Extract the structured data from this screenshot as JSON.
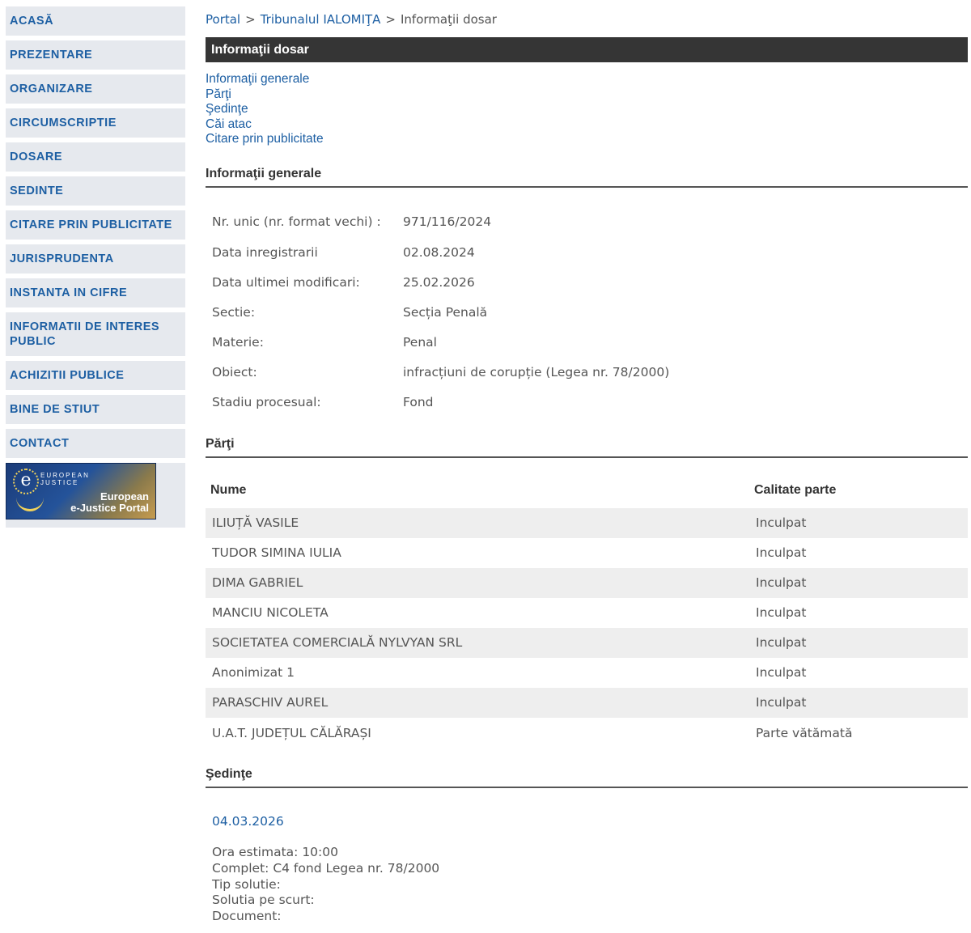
{
  "sidebar": {
    "items": [
      {
        "label": "ACASĂ"
      },
      {
        "label": "PREZENTARE"
      },
      {
        "label": "ORGANIZARE"
      },
      {
        "label": "CIRCUMSCRIPTIE"
      },
      {
        "label": "DOSARE"
      },
      {
        "label": "SEDINTE"
      },
      {
        "label": "CITARE PRIN PUBLICITATE"
      },
      {
        "label": "JURISPRUDENTA"
      },
      {
        "label": "INSTANTA IN CIFRE"
      },
      {
        "label": "INFORMATII DE INTERES PUBLIC"
      },
      {
        "label": "ACHIZITII PUBLICE"
      },
      {
        "label": "BINE DE STIUT"
      },
      {
        "label": "CONTACT"
      }
    ],
    "banner": {
      "logo_letter": "e",
      "top_text": "EUROPEAN JUSTICE",
      "line1": "European",
      "line2": "e-Justice Portal"
    }
  },
  "breadcrumb": {
    "portal": "Portal",
    "sep": ">",
    "court": "Tribunalul IALOMIŢA",
    "current": "Informaţii dosar"
  },
  "page_title": "Informaţii dosar",
  "jump_links": [
    {
      "label": "Informaţii generale"
    },
    {
      "label": "Părţi"
    },
    {
      "label": "Şedinţe"
    },
    {
      "label": "Căi atac"
    },
    {
      "label": "Citare prin publicitate"
    }
  ],
  "general": {
    "heading": "Informaţii generale",
    "rows": [
      {
        "key": "Nr. unic (nr. format vechi) :",
        "value": "971/116/2024"
      },
      {
        "key": "Data inregistrarii",
        "value": "02.08.2024"
      },
      {
        "key": "Data ultimei modificari:",
        "value": "25.02.2026"
      },
      {
        "key": "Sectie:",
        "value": "Secția Penală"
      },
      {
        "key": "Materie:",
        "value": "Penal"
      },
      {
        "key": "Obiect:",
        "value": "infracțiuni de corupție (Legea nr. 78/2000)"
      },
      {
        "key": "Stadiu procesual:",
        "value": "Fond"
      }
    ]
  },
  "parti": {
    "heading": "Părţi",
    "col_name": "Nume",
    "col_role": "Calitate parte",
    "rows": [
      {
        "name": "ILIUȚĂ VASILE",
        "role": "Inculpat"
      },
      {
        "name": "TUDOR SIMINA IULIA",
        "role": "Inculpat"
      },
      {
        "name": "DIMA GABRIEL",
        "role": "Inculpat"
      },
      {
        "name": "MANCIU NICOLETA",
        "role": "Inculpat"
      },
      {
        "name": "SOCIETATEA COMERCIALĂ NYLVYAN SRL",
        "role": "Inculpat"
      },
      {
        "name": "Anonimizat 1",
        "role": "Inculpat"
      },
      {
        "name": "PARASCHIV AUREL",
        "role": "Inculpat"
      },
      {
        "name": "U.A.T. JUDEȚUL CĂLĂRAȘI",
        "role": "Parte vătămată"
      }
    ]
  },
  "sedinte": {
    "heading": "Şedinţe",
    "date": "04.03.2026",
    "ora": "Ora estimata: 10:00",
    "complet": "Complet: C4 fond Legea nr. 78/2000",
    "tip": "Tip solutie:",
    "solutia": "Solutia pe scurt:",
    "document": "Document:"
  }
}
